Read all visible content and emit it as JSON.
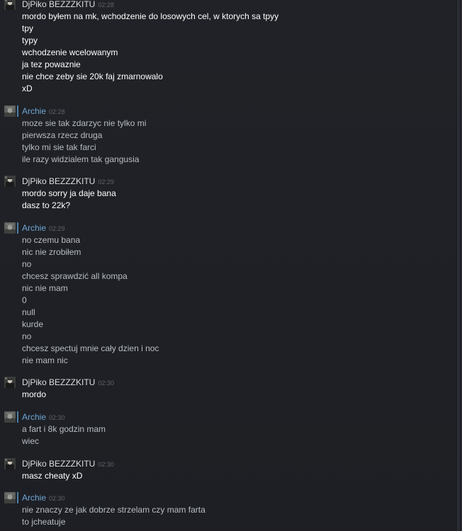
{
  "colors": {
    "background": "#1f2126",
    "self_name": "#dcdedf",
    "friend_name": "#6fa6d4",
    "self_text": "#ffffff",
    "friend_text": "#b8bdc4",
    "timestamp": "#5f646c"
  },
  "messages": [
    {
      "sender": "DjPiko BEZZZKITU",
      "time": "02:28",
      "avatar": "user-avatar-djpiko",
      "lines": [
        "mordo byłem na mk, wchodzenie do losowych cel, w ktorych sa tpyy",
        "tpy",
        "typy",
        "wchodzenie wcelowanym",
        "ja tez powaznie",
        "nie chce zeby sie 20k faj zmarnowalo",
        "xD"
      ]
    },
    {
      "sender": "Archie",
      "time": "02:28",
      "avatar": "user-avatar-archie",
      "lines": [
        "moze sie tak zdarzyc nie tylko mi",
        "pierwsza rzecz druga",
        "tylko mi sie tak farci",
        "ile razy widzialem tak gangusia"
      ]
    },
    {
      "sender": "DjPiko BEZZZKITU",
      "time": "02:29",
      "avatar": "user-avatar-djpiko",
      "lines": [
        "mordo sorry ja daje bana",
        "dasz to 22k?"
      ]
    },
    {
      "sender": "Archie",
      "time": "02:29",
      "avatar": "user-avatar-archie",
      "lines": [
        "no czemu bana",
        "nic nie zrobiłem",
        "no",
        "chcesz sprawdzić all kompa",
        "nic nie mam",
        "0",
        "null",
        "kurde",
        "no",
        "chcesz spectuj mnie cały dzien i noc",
        "nie mam nic"
      ]
    },
    {
      "sender": "DjPiko BEZZZKITU",
      "time": "02:30",
      "avatar": "user-avatar-djpiko",
      "lines": [
        "mordo"
      ]
    },
    {
      "sender": "Archie",
      "time": "02:30",
      "avatar": "user-avatar-archie",
      "lines": [
        "a fart i 8k godzin mam",
        "wiec"
      ]
    },
    {
      "sender": "DjPiko BEZZZKITU",
      "time": "02:30",
      "avatar": "user-avatar-djpiko",
      "lines": [
        "masz cheaty xD"
      ]
    },
    {
      "sender": "Archie",
      "time": "02:30",
      "avatar": "user-avatar-archie",
      "lines": [
        "nie znaczy ze jak dobrze strzelam czy mam farta",
        "to jcheatuje"
      ]
    }
  ]
}
